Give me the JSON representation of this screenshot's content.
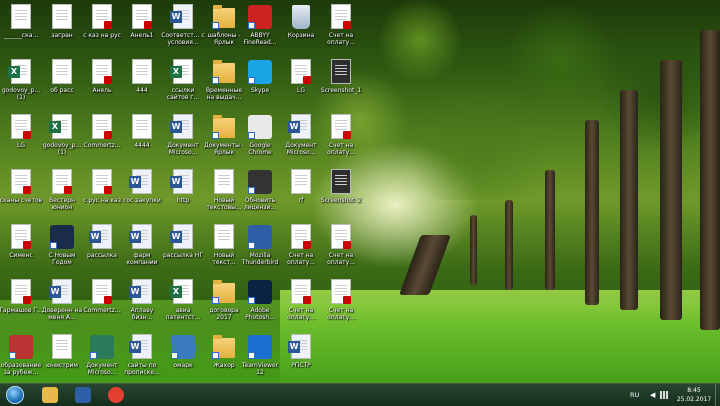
{
  "desktop": {
    "columns": [
      {
        "icons": [
          {
            "label": "______ска...",
            "type": "doc"
          },
          {
            "label": "godovoy_p... (1)",
            "type": "excel"
          },
          {
            "label": "LG",
            "type": "pdf"
          },
          {
            "label": "сканы счетов",
            "type": "pdf"
          },
          {
            "label": "Сименс",
            "type": "pdf"
          },
          {
            "label": "Гармашов Г...",
            "type": "pdf"
          },
          {
            "label": "образование за рубеж...",
            "type": "app",
            "color": "#b33"
          }
        ]
      },
      {
        "icons": [
          {
            "label": "загран",
            "type": "doc"
          },
          {
            "label": "об расс",
            "type": "doc"
          },
          {
            "label": "godovoy_p... (1)",
            "type": "excel"
          },
          {
            "label": "Вестерн юнион",
            "type": "pdf"
          },
          {
            "label": "С Новым Годом",
            "type": "app",
            "color": "#1b2b4a"
          },
          {
            "label": "Доверенн на меня А...",
            "type": "word"
          },
          {
            "label": "юнистрим",
            "type": "doc"
          }
        ]
      },
      {
        "icons": [
          {
            "label": "с каз на рус",
            "type": "pdf"
          },
          {
            "label": "Анель",
            "type": "pdf"
          },
          {
            "label": "Commertz...",
            "type": "pdf"
          },
          {
            "label": "с рус на каз",
            "type": "pdf"
          },
          {
            "label": "рассылка",
            "type": "word"
          },
          {
            "label": "Commertz...",
            "type": "pdf"
          },
          {
            "label": "Документ Microso...",
            "type": "app",
            "color": "#2b7a5a"
          }
        ]
      },
      {
        "icons": [
          {
            "label": "Анель1",
            "type": "pdf"
          },
          {
            "label": "444",
            "type": "doc"
          },
          {
            "label": "4444",
            "type": "doc"
          },
          {
            "label": "гос закупки",
            "type": "word"
          },
          {
            "label": "фарм компании",
            "type": "word"
          },
          {
            "label": "Аплаву бизн...",
            "type": "word"
          },
          {
            "label": "сайты по прописке...",
            "type": "word"
          }
        ]
      },
      {
        "icons": [
          {
            "label": "Соответст... с условия...",
            "type": "word"
          },
          {
            "label": "ссылки сайтов г...",
            "type": "excel"
          },
          {
            "label": "Документ Microso...",
            "type": "word"
          },
          {
            "label": "http",
            "type": "word"
          },
          {
            "label": "рассылка НГ",
            "type": "word"
          },
          {
            "label": "авиа патентст...",
            "type": "excel"
          },
          {
            "label": "омарк",
            "type": "app",
            "color": "#3a7ac0"
          }
        ]
      },
      {
        "icons": [
          {
            "label": "шаблоны - Ярлык",
            "type": "folder"
          },
          {
            "label": "Временные на выдач...",
            "type": "folder"
          },
          {
            "label": "Документы - Ярлык",
            "type": "folder"
          },
          {
            "label": "Новый текстовы...",
            "type": "doc"
          },
          {
            "label": "Новый текст...",
            "type": "doc"
          },
          {
            "label": "договора 2017",
            "type": "folder"
          },
          {
            "label": "Жахор",
            "type": "folder"
          }
        ]
      },
      {
        "icons": [
          {
            "label": "ABBYY FineRead...",
            "type": "app",
            "color": "#c22"
          },
          {
            "label": "Skype",
            "type": "app",
            "color": "#1aa6e6"
          },
          {
            "label": "Google Chrome",
            "type": "app",
            "color": "#e8e8e8"
          },
          {
            "label": "Обновить лицензи...",
            "type": "app",
            "color": "#333"
          },
          {
            "label": "Mozilla Thunderbird",
            "type": "app",
            "color": "#2d5ea6"
          },
          {
            "label": "Adobe Photosh...",
            "type": "app",
            "color": "#0a2340"
          },
          {
            "label": "TeamViewer 12",
            "type": "app",
            "color": "#1a6fd0"
          }
        ]
      },
      {
        "icons": [
          {
            "label": "Корзина",
            "type": "bin"
          },
          {
            "label": "LG",
            "type": "pdf"
          },
          {
            "label": "Документ Microso...",
            "type": "word"
          },
          {
            "label": "rf",
            "type": "doc"
          },
          {
            "label": "Счет на оплату...",
            "type": "pdf"
          },
          {
            "label": "Счет на оплату...",
            "type": "pdf"
          },
          {
            "label": "РПСТР",
            "type": "word"
          }
        ]
      },
      {
        "icons": [
          {
            "label": "Счет на оплату...",
            "type": "pdf"
          },
          {
            "label": "Screenshot_1",
            "type": "img"
          },
          {
            "label": "Счет на оплату...",
            "type": "pdf"
          },
          {
            "label": "Screenshot_2",
            "type": "img"
          },
          {
            "label": "Счет на оплату...",
            "type": "pdf"
          },
          {
            "label": "Счет на оплату...",
            "type": "pdf"
          }
        ]
      }
    ]
  },
  "taskbar": {
    "start_label": "Start",
    "pinned": [
      {
        "name": "explorer",
        "color": "#e6b94a"
      },
      {
        "name": "thunderbird",
        "color": "#2d5ea6"
      },
      {
        "name": "chrome",
        "color": "#e34133"
      }
    ],
    "lang": "RU",
    "time": "8:45",
    "date": "25.02.2017"
  }
}
